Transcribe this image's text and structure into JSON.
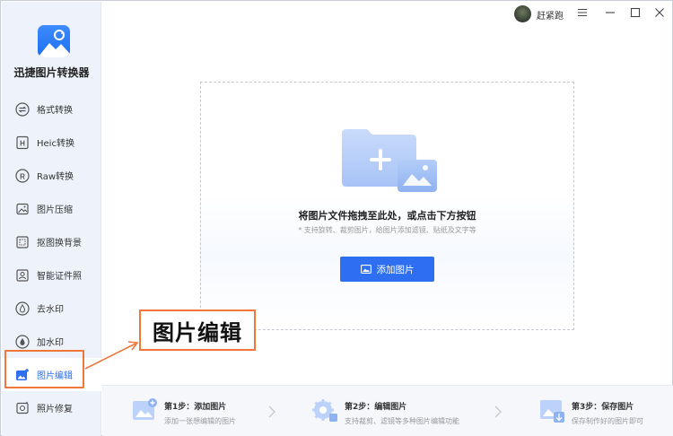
{
  "app": {
    "name": "迅捷图片转换器"
  },
  "titlebar": {
    "username": "赶紧跑"
  },
  "sidebar": {
    "items": [
      {
        "label": "格式转换",
        "icon": "swap-icon"
      },
      {
        "label": "Heic转换",
        "icon": "heic-icon"
      },
      {
        "label": "Raw转换",
        "icon": "raw-icon"
      },
      {
        "label": "图片压缩",
        "icon": "compress-icon"
      },
      {
        "label": "抠图换背景",
        "icon": "cutout-icon"
      },
      {
        "label": "智能证件照",
        "icon": "id-photo-icon"
      },
      {
        "label": "去水印",
        "icon": "remove-watermark-icon"
      },
      {
        "label": "加水印",
        "icon": "add-watermark-icon"
      },
      {
        "label": "图片编辑",
        "icon": "image-edit-icon",
        "active": true
      },
      {
        "label": "照片修复",
        "icon": "photo-repair-icon"
      }
    ]
  },
  "dropzone": {
    "title": "将图片文件拖拽至此处，或点击下方按钮",
    "subtitle": "* 支持旋转、裁剪图片，给图片添加滤镜、贴纸及文字等",
    "button_label": "添加图片"
  },
  "annotation": {
    "text": "图片编辑"
  },
  "steps": [
    {
      "title": "第1步：添加图片",
      "desc": "添加一张想编辑的图片"
    },
    {
      "title": "第2步：编辑图片",
      "desc": "支持裁剪、滤镜等多种图片编辑功能"
    },
    {
      "title": "第3步：保存图片",
      "desc": "保存制作好的图片即可"
    }
  ],
  "colors": {
    "accent": "#2e6ff2",
    "highlight": "#f0763a",
    "sidebar_bg": "#eef3fb"
  }
}
